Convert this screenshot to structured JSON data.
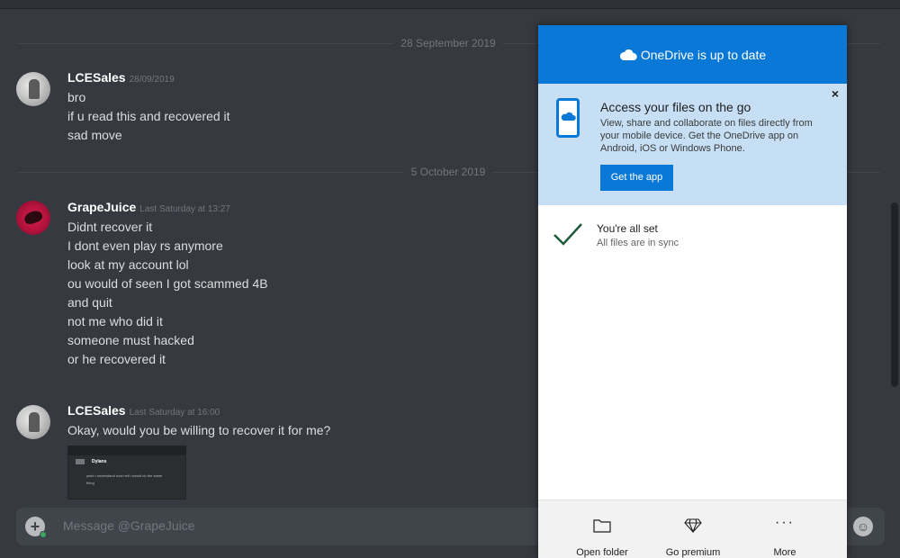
{
  "chat": {
    "dividers": [
      "28 September 2019",
      "5 October 2019"
    ],
    "messages": [
      {
        "author": "LCESales",
        "timestamp": "28/09/2019",
        "lines": [
          "bro",
          "if u read this and recovered it",
          "sad move"
        ]
      },
      {
        "author": "GrapeJuice",
        "timestamp": "Last Saturday at 13:27",
        "lines": [
          "Didnt recover it",
          "I dont even play rs anymore",
          "look at my account lol",
          "ou would of seen I got scammed 4B",
          "and quit",
          "not me who  did it",
          "someone must hacked",
          "or he recovered it"
        ]
      },
      {
        "author": "LCESales",
        "timestamp": "Last Saturday at 16:00",
        "lines": [
          "Okay, would you be willing to recover it for me?"
        ],
        "attachment": {
          "title": "Dylans",
          "line1": "yeah i understand now hell i would do the same",
          "line2": "thing"
        }
      }
    ]
  },
  "composer": {
    "placeholder": "Message @GrapeJuice",
    "plus_icon": "plus-circle-icon",
    "emoji_icon": "emoji-icon"
  },
  "onedrive": {
    "header_title": "OneDrive is up to date",
    "promo": {
      "title": "Access your files on the go",
      "description": "View, share and collaborate on files directly from your mobile device. Get the OneDrive app on Android, iOS or Windows Phone.",
      "button": "Get the app",
      "close": "×"
    },
    "status": {
      "title": "You're all set",
      "subtitle": "All files are in sync"
    },
    "footer": [
      {
        "label": "Open folder",
        "icon": "folder-icon"
      },
      {
        "label": "Go premium",
        "icon": "diamond-icon"
      },
      {
        "label": "More",
        "icon": "more-icon"
      }
    ],
    "colors": {
      "accent": "#0a78d7",
      "promo_bg": "#c6dff4",
      "check": "#1f5a3a"
    }
  }
}
